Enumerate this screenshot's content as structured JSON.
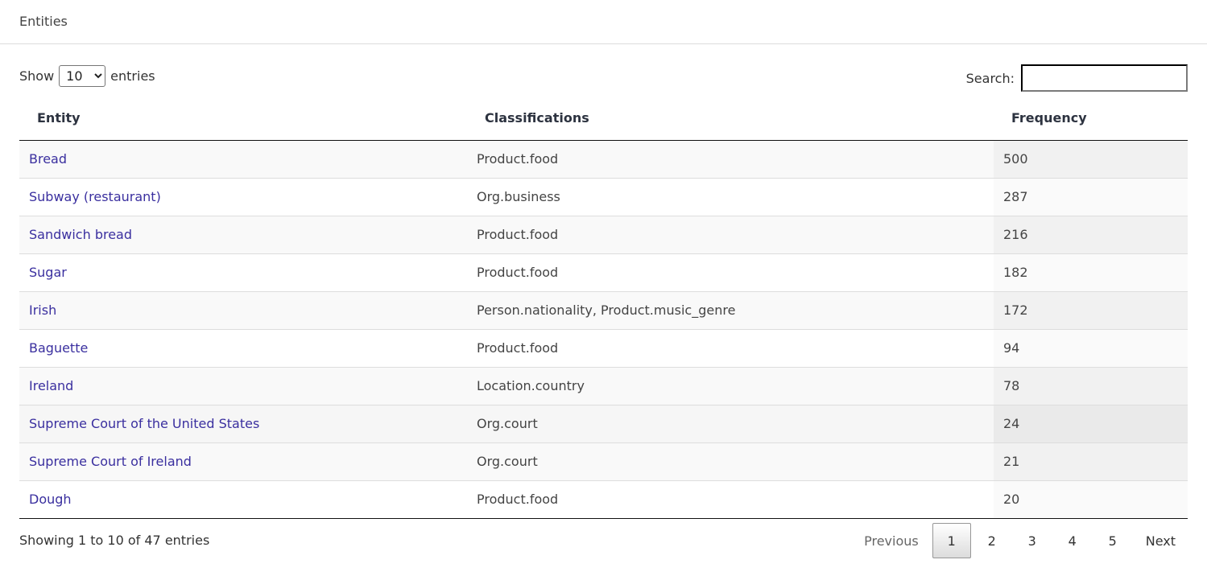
{
  "header": {
    "title": "Entities"
  },
  "length": {
    "label_before": "Show",
    "selected": "10",
    "label_after": "entries"
  },
  "search": {
    "label": "Search:",
    "value": "",
    "placeholder": ""
  },
  "table": {
    "columns": [
      "Entity",
      "Classifications",
      "Frequency"
    ],
    "sorted_column": "Frequency",
    "rows": [
      {
        "entity": "Bread",
        "classifications": "Product.food",
        "frequency": "500"
      },
      {
        "entity": "Subway (restaurant)",
        "classifications": "Org.business",
        "frequency": "287"
      },
      {
        "entity": "Sandwich bread",
        "classifications": "Product.food",
        "frequency": "216"
      },
      {
        "entity": "Sugar",
        "classifications": "Product.food",
        "frequency": "182"
      },
      {
        "entity": "Irish",
        "classifications": "Person.nationality, Product.music_genre",
        "frequency": "172"
      },
      {
        "entity": "Baguette",
        "classifications": "Product.food",
        "frequency": "94"
      },
      {
        "entity": "Ireland",
        "classifications": "Location.country",
        "frequency": "78"
      },
      {
        "entity": "Supreme Court of the United States",
        "classifications": "Org.court",
        "frequency": "24"
      },
      {
        "entity": "Supreme Court of Ireland",
        "classifications": "Org.court",
        "frequency": "21"
      },
      {
        "entity": "Dough",
        "classifications": "Product.food",
        "frequency": "20"
      }
    ],
    "hovered_row": 7
  },
  "footer": {
    "info": "Showing 1 to 10 of 47 entries",
    "pagination": {
      "previous": "Previous",
      "pages": [
        "1",
        "2",
        "3",
        "4",
        "5"
      ],
      "current": "1",
      "next": "Next"
    }
  },
  "colors": {
    "link": "#3a2f9f",
    "stripe": "#f9f9f9",
    "sorted_stripe": "#f1f1f1",
    "hover": "#f6f6f6"
  }
}
